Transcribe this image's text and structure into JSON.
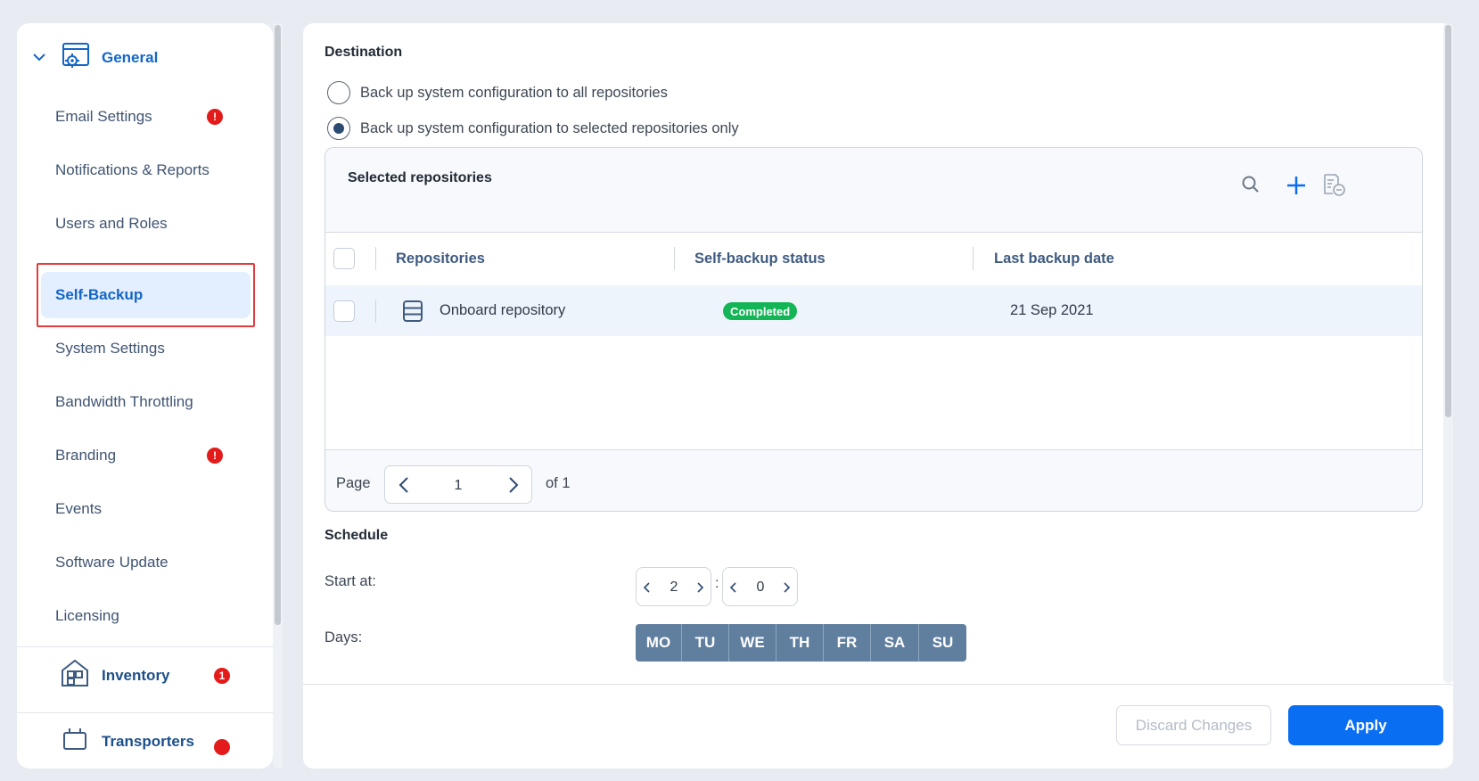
{
  "sidebar": {
    "group_label": "General",
    "items": [
      {
        "label": "Email Settings",
        "alert": "!"
      },
      {
        "label": "Notifications & Reports"
      },
      {
        "label": "Users and Roles"
      },
      {
        "label": "Self-Backup"
      },
      {
        "label": "System Settings"
      },
      {
        "label": "Bandwidth Throttling"
      },
      {
        "label": "Branding",
        "alert": "!"
      },
      {
        "label": "Events"
      },
      {
        "label": "Software Update"
      },
      {
        "label": "Licensing"
      }
    ],
    "inventory": {
      "label": "Inventory",
      "badge": "1"
    },
    "transporters": {
      "label": "Transporters"
    }
  },
  "destination": {
    "title": "Destination",
    "option_all": "Back up system configuration to all repositories",
    "option_selected": "Back up system configuration to selected repositories only",
    "selected_option": "selected"
  },
  "repositories": {
    "title": "Selected repositories",
    "columns": [
      "Repositories",
      "Self-backup status",
      "Last backup date"
    ],
    "rows": [
      {
        "name": "Onboard repository",
        "status": "Completed",
        "date": "21 Sep 2021"
      }
    ],
    "pager": {
      "label": "Page",
      "value": "1",
      "of": "of 1"
    }
  },
  "schedule": {
    "title": "Schedule",
    "start_label": "Start at:",
    "hour": "2",
    "minute": "0",
    "colon": ":",
    "days_label": "Days:",
    "days": [
      "MO",
      "TU",
      "WE",
      "TH",
      "FR",
      "SA",
      "SU"
    ]
  },
  "footer": {
    "discard_label": "Discard Changes",
    "apply_label": "Apply"
  },
  "colors": {
    "accent": "#0a6ef3",
    "active_nav": "#1466c6",
    "status_completed": "#14b556",
    "alert": "#e41b1b",
    "day_chip": "#607f9f"
  }
}
